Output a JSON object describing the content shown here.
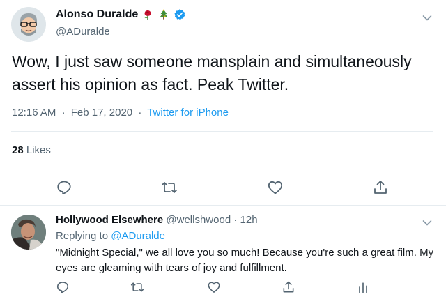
{
  "tweet": {
    "author_name": "Alonso Duralde",
    "author_emojis": [
      "rose-emoji",
      "christmas-tree-emoji"
    ],
    "verified": true,
    "handle": "@ADuralde",
    "text": "Wow, I just saw someone mansplain and simultaneously assert his opinion as fact. Peak Twitter.",
    "time": "12:16 AM",
    "date": "Feb 17, 2020",
    "source": "Twitter for iPhone",
    "separator": "·",
    "likes_count": "28",
    "likes_label": "Likes",
    "actions": [
      "reply-icon",
      "retweet-icon",
      "like-icon",
      "share-icon"
    ]
  },
  "reply": {
    "author_name": "Hollywood Elsewhere",
    "handle": "@wellshwood",
    "separator": "·",
    "age": "12h",
    "replying_prefix": "Replying to",
    "replying_to": "@ADuralde",
    "text": "\"Midnight Special,\" we all love you so much!  Because you're such a great film.  My eyes are gleaming with tears of joy and fulfillment.",
    "actions": [
      "reply-icon",
      "retweet-icon",
      "like-icon",
      "share-icon",
      "analytics-icon"
    ]
  },
  "colors": {
    "link": "#1d9bf0",
    "secondary_text": "#536471",
    "primary_text": "#0f1419",
    "verified": "#1d9bf0",
    "divider": "#e6ecf0"
  }
}
